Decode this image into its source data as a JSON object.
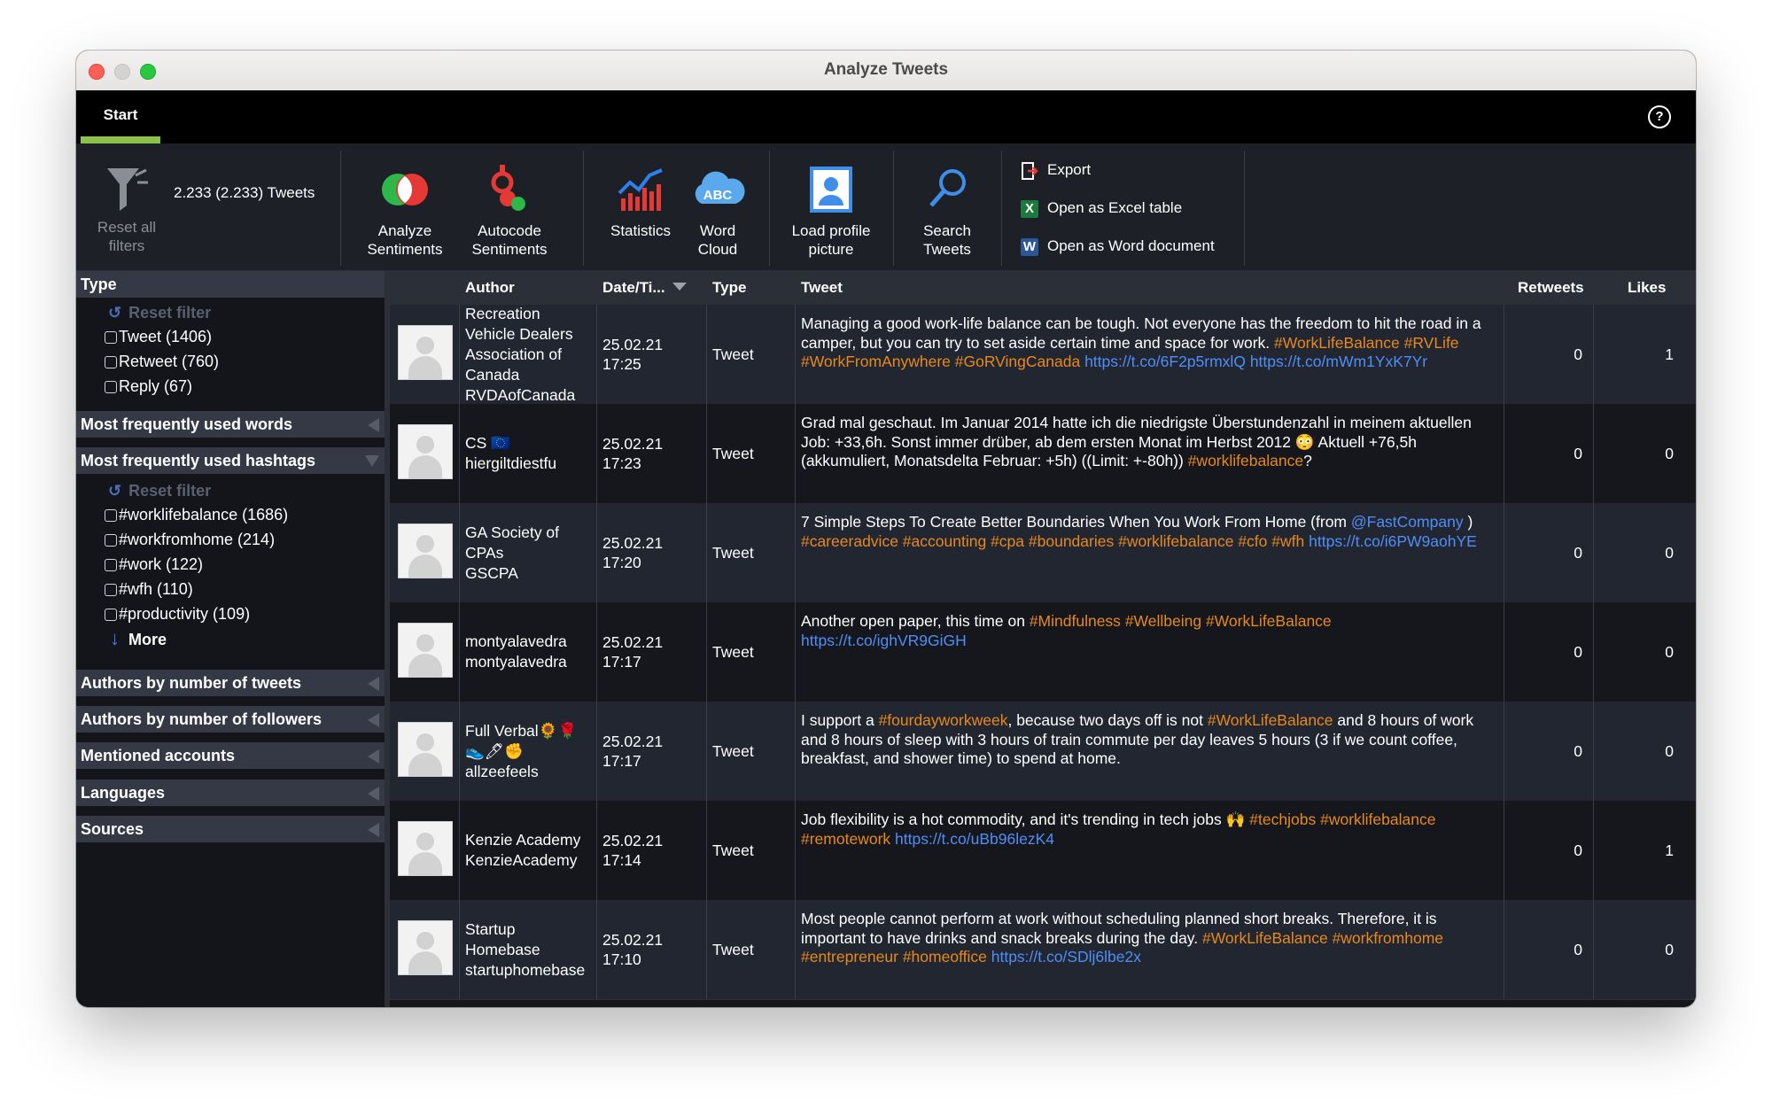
{
  "window": {
    "title": "Analyze Tweets"
  },
  "tabs": [
    {
      "label": "Start",
      "active": true
    }
  ],
  "help_icon": "?",
  "ribbon": {
    "reset_filters_label_1": "Reset all",
    "reset_filters_label_2": "filters",
    "tweet_count": "2.233 (2.233) Tweets",
    "analyze_sentiments_1": "Analyze",
    "analyze_sentiments_2": "Sentiments",
    "autocode_sentiments_1": "Autocode",
    "autocode_sentiments_2": "Sentiments",
    "statistics": "Statistics",
    "word_cloud_1": "Word",
    "word_cloud_2": "Cloud",
    "word_cloud_icon_text": "ABC",
    "load_profile_1": "Load profile",
    "load_profile_2": "picture",
    "search_tweets_1": "Search",
    "search_tweets_2": "Tweets",
    "export": "Export",
    "open_excel": "Open as Excel table",
    "excel_icon_letter": "X",
    "open_word": "Open as Word document",
    "word_icon_letter": "W"
  },
  "sidebar": {
    "type_section": {
      "title": "Type",
      "reset_filter": "Reset filter",
      "items": [
        "Tweet (1406)",
        "Retweet (760)",
        "Reply (67)"
      ]
    },
    "words_section": {
      "title": "Most frequently used words"
    },
    "hashtags_section": {
      "title": "Most frequently used hashtags",
      "reset_filter": "Reset filter",
      "items": [
        "#worklifebalance (1686)",
        "#workfromhome (214)",
        "#work (122)",
        "#wfh (110)",
        "#productivity (109)"
      ],
      "more": "More"
    },
    "authors_tweets": {
      "title": "Authors by number of tweets"
    },
    "authors_followers": {
      "title": "Authors by number of followers"
    },
    "mentioned": {
      "title": "Mentioned accounts"
    },
    "languages": {
      "title": "Languages"
    },
    "sources": {
      "title": "Sources"
    }
  },
  "table": {
    "headers": {
      "author": "Author",
      "date": "Date/Ti...",
      "type": "Type",
      "tweet": "Tweet",
      "retweets": "Retweets",
      "likes": "Likes"
    },
    "rows": [
      {
        "author_lines": [
          "Recreation",
          "Vehicle Dealers",
          "Association of",
          "Canada",
          "RVDAofCanada"
        ],
        "date": "25.02.21",
        "time": "17:25",
        "type": "Tweet",
        "tweet": [
          {
            "t": "Managing a good work-life balance can be tough. Not everyone has the freedom to hit the road in a camper, but you can try to set aside certain time and space for work. ",
            "k": "text"
          },
          {
            "t": "#WorkLifeBalance",
            "k": "tag"
          },
          {
            "t": " ",
            "k": "text"
          },
          {
            "t": "#RVLife",
            "k": "tag"
          },
          {
            "t": " ",
            "k": "text"
          },
          {
            "t": "#WorkFromAnywhere",
            "k": "tag"
          },
          {
            "t": " ",
            "k": "text"
          },
          {
            "t": "#GoRVingCanada",
            "k": "tag"
          },
          {
            "t": " ",
            "k": "text"
          },
          {
            "t": "https://t.co/6F2p5rmxlQ",
            "k": "url"
          },
          {
            "t": " ",
            "k": "text"
          },
          {
            "t": "https://t.co/mWm1YxK7Yr",
            "k": "url"
          }
        ],
        "retweets": "0",
        "likes": "1"
      },
      {
        "author_lines": [
          "CS 🇪🇺",
          "hiergiltdiestfu"
        ],
        "date": "25.02.21",
        "time": "17:23",
        "type": "Tweet",
        "tweet": [
          {
            "t": "Grad mal geschaut. Im Januar 2014 hatte ich die niedrigste Überstundenzahl in meinem aktuellen Job: +33,6h. Sonst immer drüber, ab dem ersten Monat im Herbst 2012 😳 Aktuell +76,5h (akkumuliert, Monatsdelta Februar: +5h) ((Limit: +-80h)) ",
            "k": "text"
          },
          {
            "t": "#worklifebalance",
            "k": "tag"
          },
          {
            "t": "?",
            "k": "text"
          }
        ],
        "retweets": "0",
        "likes": "0"
      },
      {
        "author_lines": [
          "GA Society of",
          "CPAs",
          "GSCPA"
        ],
        "date": "25.02.21",
        "time": "17:20",
        "type": "Tweet",
        "tweet": [
          {
            "t": "7 Simple Steps To Create Better Boundaries When You Work From Home (from ",
            "k": "text"
          },
          {
            "t": "@FastCompany",
            "k": "mention"
          },
          {
            "t": " ) ",
            "k": "text"
          },
          {
            "t": "#careeradvice",
            "k": "tag"
          },
          {
            "t": " ",
            "k": "text"
          },
          {
            "t": "#accounting",
            "k": "tag"
          },
          {
            "t": " ",
            "k": "text"
          },
          {
            "t": "#cpa",
            "k": "tag"
          },
          {
            "t": " ",
            "k": "text"
          },
          {
            "t": "#boundaries",
            "k": "tag"
          },
          {
            "t": " ",
            "k": "text"
          },
          {
            "t": "#worklifebalance",
            "k": "tag"
          },
          {
            "t": " ",
            "k": "text"
          },
          {
            "t": "#cfo",
            "k": "tag"
          },
          {
            "t": " ",
            "k": "text"
          },
          {
            "t": "#wfh",
            "k": "tag"
          },
          {
            "t": " ",
            "k": "text"
          },
          {
            "t": "https://t.co/i6PW9aohYE",
            "k": "url"
          }
        ],
        "retweets": "0",
        "likes": "0"
      },
      {
        "author_lines": [
          "montyalavedra",
          "montyalavedra"
        ],
        "date": "25.02.21",
        "time": "17:17",
        "type": "Tweet",
        "tweet": [
          {
            "t": "Another open paper, this time on ",
            "k": "text"
          },
          {
            "t": "#Mindfulness",
            "k": "tag"
          },
          {
            "t": " ",
            "k": "text"
          },
          {
            "t": "#Wellbeing",
            "k": "tag"
          },
          {
            "t": " ",
            "k": "text"
          },
          {
            "t": "#WorkLifeBalance",
            "k": "tag"
          },
          {
            "t": " ",
            "k": "text"
          },
          {
            "t": "https://t.co/ighVR9GiGH",
            "k": "url"
          }
        ],
        "retweets": "0",
        "likes": "0"
      },
      {
        "author_lines": [
          "Full Verbal🌻🌹",
          "👟🖊✊",
          "allzeefeels"
        ],
        "date": "25.02.21",
        "time": "17:17",
        "type": "Tweet",
        "tweet": [
          {
            "t": "I support a ",
            "k": "text"
          },
          {
            "t": "#fourdayworkweek",
            "k": "tag"
          },
          {
            "t": ", because two days off is not ",
            "k": "text"
          },
          {
            "t": "#WorkLifeBalance",
            "k": "tag"
          },
          {
            "t": " and 8 hours of work and 8 hours of sleep with 3 hours of train commute per day leaves 5 hours (3 if we count coffee, breakfast, and shower time) to spend at home.",
            "k": "text"
          }
        ],
        "retweets": "0",
        "likes": "0"
      },
      {
        "author_lines": [
          "Kenzie Academy",
          "KenzieAcademy"
        ],
        "date": "25.02.21",
        "time": "17:14",
        "type": "Tweet",
        "tweet": [
          {
            "t": "Job flexibility is a hot commodity, and it's trending in tech jobs 🙌 ",
            "k": "text"
          },
          {
            "t": "#techjobs",
            "k": "tag"
          },
          {
            "t": " ",
            "k": "text"
          },
          {
            "t": "#worklifebalance",
            "k": "tag"
          },
          {
            "t": " ",
            "k": "text"
          },
          {
            "t": "#remotework",
            "k": "tag"
          },
          {
            "t": " ",
            "k": "text"
          },
          {
            "t": "https://t.co/uBb96lezK4",
            "k": "url"
          }
        ],
        "retweets": "0",
        "likes": "1"
      },
      {
        "author_lines": [
          "Startup",
          "Homebase",
          "startuphomebase"
        ],
        "date": "25.02.21",
        "time": "17:10",
        "type": "Tweet",
        "tweet": [
          {
            "t": "Most people cannot perform at work without scheduling planned short breaks. Therefore, it is important to have drinks and snack breaks during the day. ",
            "k": "text"
          },
          {
            "t": "#WorkLifeBalance",
            "k": "tag"
          },
          {
            "t": " ",
            "k": "text"
          },
          {
            "t": "#workfromhome",
            "k": "tag"
          },
          {
            "t": " ",
            "k": "text"
          },
          {
            "t": "#entrepreneur",
            "k": "tag"
          },
          {
            "t": " ",
            "k": "text"
          },
          {
            "t": "#homeoffice",
            "k": "tag"
          },
          {
            "t": " ",
            "k": "text"
          },
          {
            "t": "https://t.co/SDlj6lbe2x",
            "k": "url"
          }
        ],
        "retweets": "0",
        "likes": "0"
      }
    ]
  }
}
